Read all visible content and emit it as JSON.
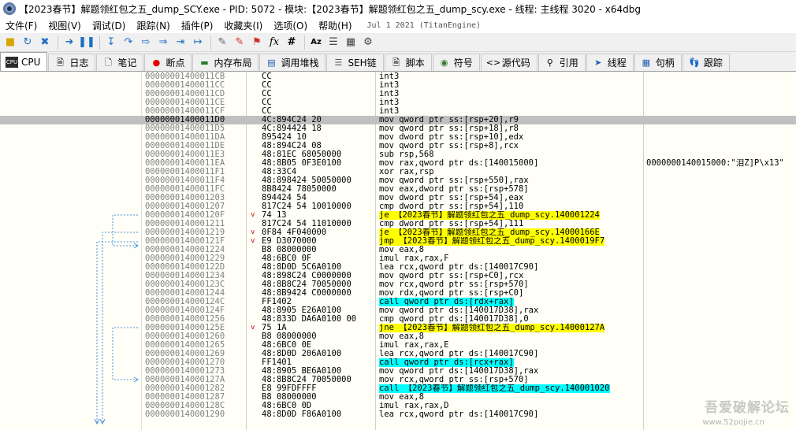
{
  "window": {
    "title": "【2023春节】解题领红包之五_dump_SCY.exe - PID: 5072 - 模块:【2023春节】解题领红包之五_dump_scy.exe - 线程: 主线程 3020 - x64dbg"
  },
  "menu": {
    "items": [
      "文件(F)",
      "视图(V)",
      "调试(D)",
      "跟踪(N)",
      "插件(P)",
      "收藏夹(I)",
      "选项(O)",
      "帮助(H)"
    ],
    "date": "Jul 1 2021 (TitanEngine)"
  },
  "toolbar": {
    "icons": [
      "open-icon",
      "restart-icon",
      "stop-icon",
      "run-icon",
      "pause-icon",
      "step-into-icon",
      "step-over-icon",
      "trace-into-icon",
      "trace-over-icon",
      "execute-till-return-icon",
      "run-to-user-icon",
      "comment-icon",
      "label-icon",
      "bookmark-icon",
      "function-icon",
      "hash-icon",
      "font-icon",
      "strings-icon",
      "calculator-icon",
      "settings-icon"
    ]
  },
  "tabs": [
    {
      "icon": "cpu-icon",
      "label": "CPU"
    },
    {
      "icon": "log-icon",
      "label": "日志"
    },
    {
      "icon": "notes-icon",
      "label": "笔记"
    },
    {
      "icon": "breakpoint-icon",
      "label": "断点"
    },
    {
      "icon": "memory-icon",
      "label": "内存布局"
    },
    {
      "icon": "callstack-icon",
      "label": "调用堆栈"
    },
    {
      "icon": "seh-icon",
      "label": "SEH链"
    },
    {
      "icon": "script-icon",
      "label": "脚本"
    },
    {
      "icon": "symbols-icon",
      "label": "符号"
    },
    {
      "icon": "source-icon",
      "label": "源代码"
    },
    {
      "icon": "references-icon",
      "label": "引用"
    },
    {
      "icon": "threads-icon",
      "label": "线程"
    },
    {
      "icon": "handles-icon",
      "label": "句柄"
    },
    {
      "icon": "trace-icon",
      "label": "跟踪"
    }
  ],
  "disassembly": [
    {
      "addr": "00000001400011CB",
      "bytes": "CC",
      "asm": "int3"
    },
    {
      "addr": "00000001400011CC",
      "bytes": "CC",
      "asm": "int3"
    },
    {
      "addr": "00000001400011CD",
      "bytes": "CC",
      "asm": "int3"
    },
    {
      "addr": "00000001400011CE",
      "bytes": "CC",
      "asm": "int3"
    },
    {
      "addr": "00000001400011CF",
      "bytes": "CC",
      "asm": "int3"
    },
    {
      "addr": "00000001400011D0",
      "bytes": "4C:894C24 20",
      "asm": "mov qword ptr ss:[rsp+20],r9",
      "current": true
    },
    {
      "addr": "00000001400011D5",
      "bytes": "4C:894424 18",
      "asm": "mov qword ptr ss:[rsp+18],r8"
    },
    {
      "addr": "00000001400011DA",
      "bytes": "895424 10",
      "asm": "mov dword ptr ss:[rsp+10],edx"
    },
    {
      "addr": "00000001400011DE",
      "bytes": "48:894C24 08",
      "asm": "mov qword ptr ss:[rsp+8],rcx"
    },
    {
      "addr": "00000001400011E3",
      "bytes": "48:81EC 68050000",
      "asm": "sub rsp,568"
    },
    {
      "addr": "00000001400011EA",
      "bytes": "48:8B05 0F3E0100",
      "asm": "mov rax,qword ptr ds:[140015000]",
      "comment": "0000000140015000:\"泪Z]P\\x13\""
    },
    {
      "addr": "00000001400011F1",
      "bytes": "48:33C4",
      "asm": "xor rax,rsp"
    },
    {
      "addr": "00000001400011F4",
      "bytes": "48:898424 50050000",
      "asm": "mov qword ptr ss:[rsp+550],rax"
    },
    {
      "addr": "00000001400011FC",
      "bytes": "8B8424 78050000",
      "asm": "mov eax,dword ptr ss:[rsp+578]"
    },
    {
      "addr": "0000000140001203",
      "bytes": "894424 54",
      "asm": "mov dword ptr ss:[rsp+54],eax"
    },
    {
      "addr": "0000000140001207",
      "bytes": "817C24 54 10010000",
      "asm": "cmp dword ptr ss:[rsp+54],110"
    },
    {
      "addr": "000000014000120F",
      "bytes": "74 13",
      "asm": "je 【2023春节】解题领红包之五_dump_scy.140001224",
      "arrow": "v",
      "kind": "jcc"
    },
    {
      "addr": "0000000140001211",
      "bytes": "817C24 54 11010000",
      "asm": "cmp dword ptr ss:[rsp+54],111"
    },
    {
      "addr": "0000000140001219",
      "bytes": "0F84 4F040000",
      "asm": "je 【2023春节】解题领红包之五_dump_scy.14000166E",
      "arrow": "v",
      "kind": "jcc"
    },
    {
      "addr": "000000014000121F",
      "bytes": "E9 D3070000",
      "asm": "jmp 【2023春节】解题领红包之五_dump_scy.1400019F7",
      "arrow": "v",
      "kind": "jcc"
    },
    {
      "addr": "0000000140001224",
      "bytes": "B8 08000000",
      "asm": "mov eax,8"
    },
    {
      "addr": "0000000140001229",
      "bytes": "48:6BC0 0F",
      "asm": "imul rax,rax,F"
    },
    {
      "addr": "000000014000122D",
      "bytes": "48:8D0D 5C6A0100",
      "asm": "lea rcx,qword ptr ds:[140017C90]"
    },
    {
      "addr": "0000000140001234",
      "bytes": "48:898C24 C0000000",
      "asm": "mov qword ptr ss:[rsp+C0],rcx"
    },
    {
      "addr": "000000014000123C",
      "bytes": "48:8B8C24 70050000",
      "asm": "mov rcx,qword ptr ss:[rsp+570]"
    },
    {
      "addr": "0000000140001244",
      "bytes": "48:8B9424 C0000000",
      "asm": "mov rdx,qword ptr ss:[rsp+C0]"
    },
    {
      "addr": "000000014000124C",
      "bytes": "FF1402",
      "asm": "call qword ptr ds:[rdx+rax]",
      "kind": "call"
    },
    {
      "addr": "000000014000124F",
      "bytes": "48:8905 E26A0100",
      "asm": "mov qword ptr ds:[140017D38],rax"
    },
    {
      "addr": "0000000140001256",
      "bytes": "48:833D DA6A0100 00",
      "asm": "cmp qword ptr ds:[140017D38],0"
    },
    {
      "addr": "000000014000125E",
      "bytes": "75 1A",
      "asm": "jne 【2023春节】解题领红包之五_dump_scy.14000127A",
      "arrow": "v",
      "kind": "jcc"
    },
    {
      "addr": "0000000140001260",
      "bytes": "B8 08000000",
      "asm": "mov eax,8"
    },
    {
      "addr": "0000000140001265",
      "bytes": "48:6BC0 0E",
      "asm": "imul rax,rax,E"
    },
    {
      "addr": "0000000140001269",
      "bytes": "48:8D0D 206A0100",
      "asm": "lea rcx,qword ptr ds:[140017C90]"
    },
    {
      "addr": "0000000140001270",
      "bytes": "FF1401",
      "asm": "call qword ptr ds:[rcx+rax]",
      "kind": "call"
    },
    {
      "addr": "0000000140001273",
      "bytes": "48:8905 BE6A0100",
      "asm": "mov qword ptr ds:[140017D38],rax"
    },
    {
      "addr": "000000014000127A",
      "bytes": "48:8B8C24 70050000",
      "asm": "mov rcx,qword ptr ss:[rsp+570]"
    },
    {
      "addr": "0000000140001282",
      "bytes": "E8 99FDFFFF",
      "asm": "call 【2023春节】解题领红包之五_dump_scy.140001020",
      "kind": "call"
    },
    {
      "addr": "0000000140001287",
      "bytes": "B8 08000000",
      "asm": "mov eax,8"
    },
    {
      "addr": "000000014000128C",
      "bytes": "48:6BC0 0D",
      "asm": "imul rax,rax,D"
    },
    {
      "addr": "0000000140001290",
      "bytes": "48:8D0D F86A0100",
      "asm": "lea rcx,qword ptr ds:[140017C90]"
    }
  ],
  "watermark": {
    "main": "吾爱破解论坛",
    "sub": "www.52pojie.cn"
  }
}
